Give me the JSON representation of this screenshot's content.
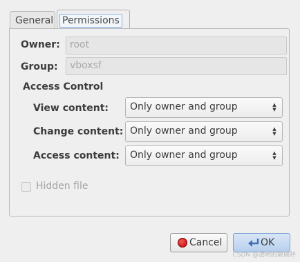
{
  "tabs": {
    "general": "General",
    "permissions": "Permissions"
  },
  "owner": {
    "label": "Owner:",
    "value": "root"
  },
  "group": {
    "label": "Group:",
    "value": "vboxsf"
  },
  "access_control": {
    "title": "Access Control",
    "view": {
      "label": "View content:",
      "value": "Only owner and group"
    },
    "change": {
      "label": "Change content:",
      "value": "Only owner and group"
    },
    "access": {
      "label": "Access content:",
      "value": "Only owner and group"
    }
  },
  "hidden_file": {
    "label": "Hidden file",
    "checked": false
  },
  "buttons": {
    "cancel": "Cancel",
    "ok": "OK"
  },
  "watermark": "CSDN @透明的玻璃杯",
  "icons": {
    "cancel": "stop-circle-icon",
    "ok": "enter-arrow-icon",
    "combo": "up-down-arrows-icon"
  },
  "colors": {
    "cancel_icon": "#c20000",
    "ok_button": "#b7cfec",
    "tab_focus": "#88aede"
  }
}
